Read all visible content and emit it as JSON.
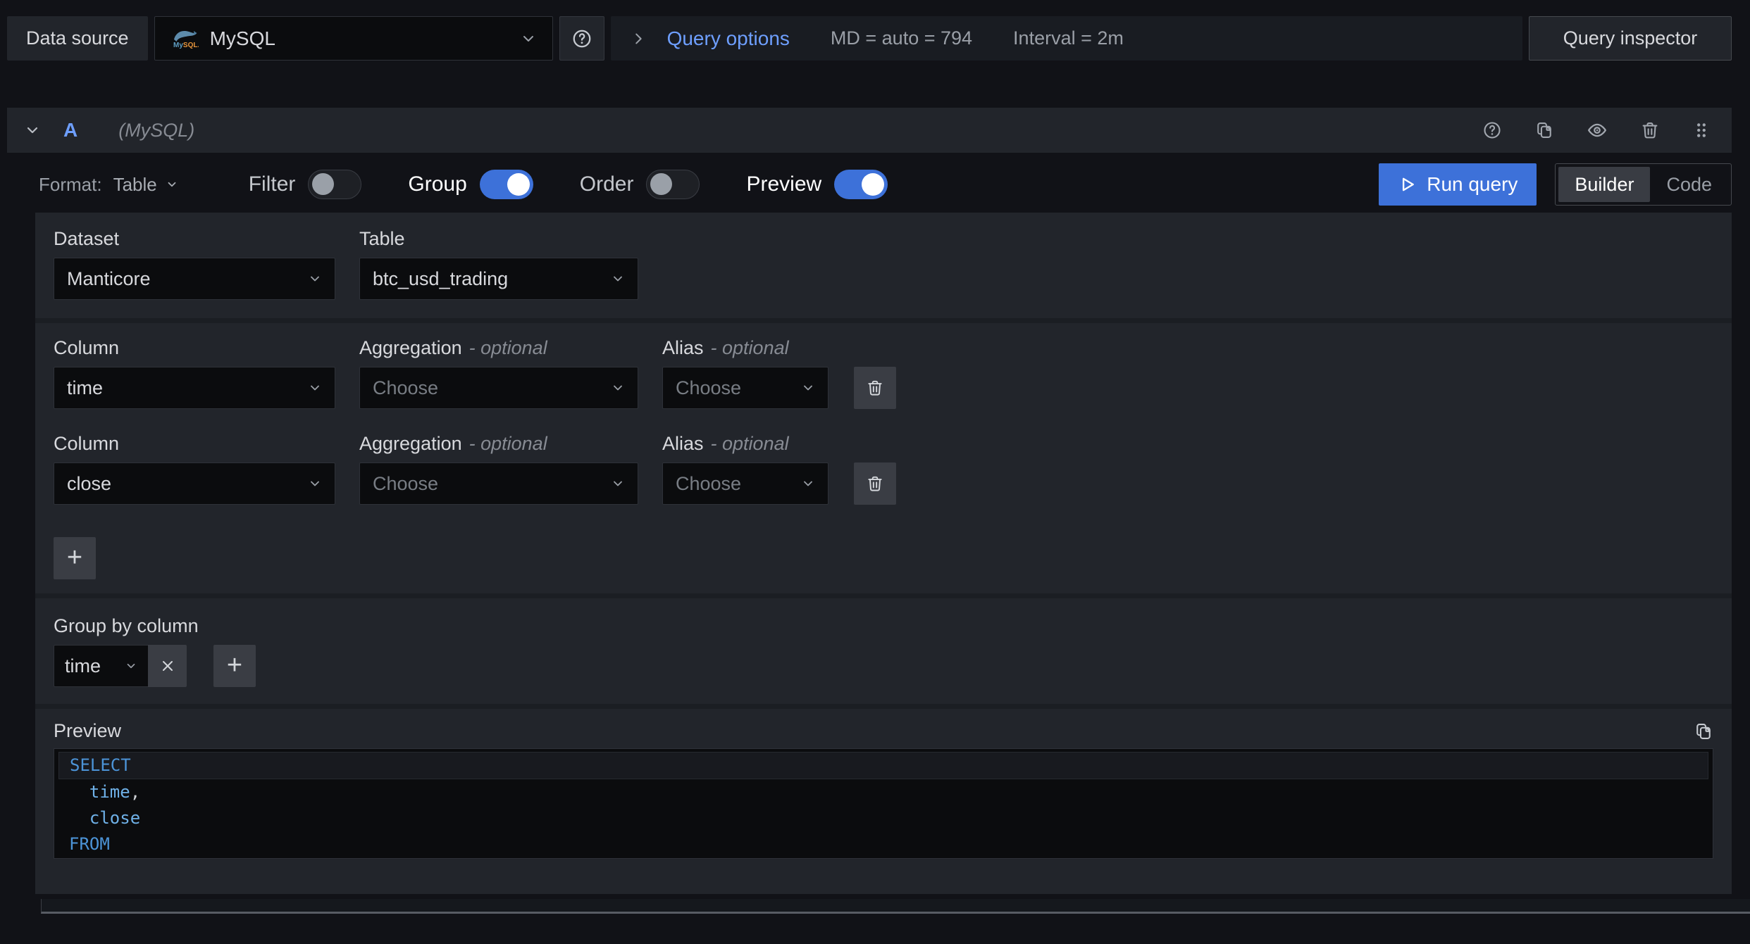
{
  "topbar": {
    "datasource_label": "Data source",
    "datasource_value": "MySQL",
    "query_options_label": "Query options",
    "max_data_points": "MD = auto = 794",
    "interval": "Interval = 2m",
    "query_inspector_label": "Query inspector"
  },
  "query_header": {
    "ref_id": "A",
    "datasource_hint": "(MySQL)"
  },
  "toolbar": {
    "format_label": "Format:",
    "format_value": "Table",
    "toggles": [
      {
        "label": "Filter",
        "on": false
      },
      {
        "label": "Group",
        "on": true
      },
      {
        "label": "Order",
        "on": false
      },
      {
        "label": "Preview",
        "on": true
      }
    ],
    "run_query_label": "Run query",
    "modes": [
      {
        "label": "Builder",
        "active": true
      },
      {
        "label": "Code",
        "active": false
      }
    ]
  },
  "editor": {
    "dataset": {
      "label": "Dataset",
      "value": "Manticore"
    },
    "table": {
      "label": "Table",
      "value": "btc_usd_trading"
    },
    "columns": [
      {
        "column_label": "Column",
        "column_value": "time",
        "aggregation_label": "Aggregation",
        "aggregation_optional": "- optional",
        "aggregation_value": "Choose",
        "alias_label": "Alias",
        "alias_optional": "- optional",
        "alias_value": "Choose"
      },
      {
        "column_label": "Column",
        "column_value": "close",
        "aggregation_label": "Aggregation",
        "aggregation_optional": "- optional",
        "aggregation_value": "Choose",
        "alias_label": "Alias",
        "alias_optional": "- optional",
        "alias_value": "Choose"
      }
    ],
    "group_by": {
      "label": "Group by column",
      "value": "time"
    },
    "preview": {
      "label": "Preview",
      "sql": {
        "line1_keyword": "SELECT",
        "line2_identifier": "  time",
        "line2_punctuation": ",",
        "line3_identifier": "  close",
        "line4_keyword": "FROM"
      }
    }
  },
  "colors": {
    "accent_blue": "#3d71d9",
    "link_blue": "#6e9fff",
    "panel_bg": "#22252b",
    "canvas_bg": "#111217",
    "sql_keyword": "#4c94d8",
    "sql_identifier": "#6fb1e8"
  }
}
